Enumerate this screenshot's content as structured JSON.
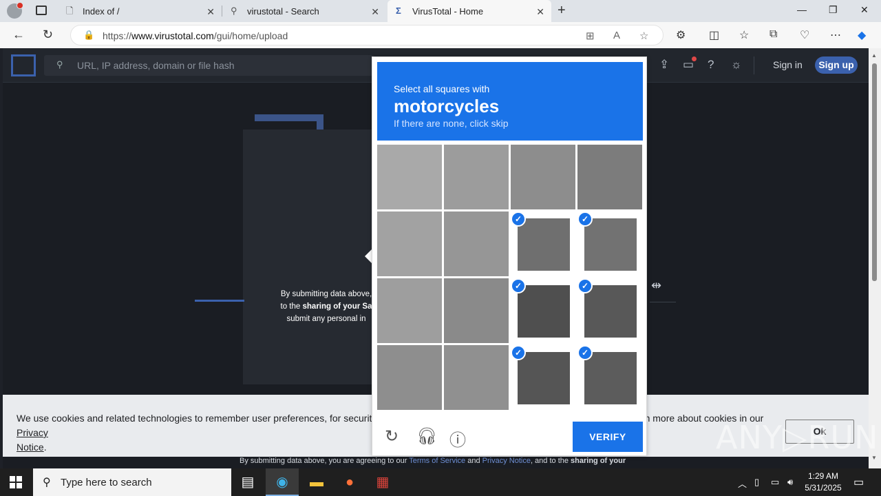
{
  "browser": {
    "tabs": [
      {
        "title": "Index of /",
        "icon": "page-icon"
      },
      {
        "title": "virustotal - Search",
        "icon": "search-icon"
      },
      {
        "title": "VirusTotal - Home",
        "icon": "virustotal-icon"
      }
    ],
    "url_prefix": "https://",
    "url_domain": "www.virustotal.com",
    "url_path": "/gui/home/upload"
  },
  "vt": {
    "search_placeholder": "URL, IP address, domain or file hash",
    "sign_in": "Sign in",
    "sign_up": "Sign up",
    "submit_note_1": "By submitting data above,",
    "submit_note_2": "to the",
    "submit_note_bold": "sharing of your Sa",
    "submit_note_3": "submit any personal in",
    "cookie_text": "We use cookies and related technologies to remember user preferences, for security, to analyse our traffic, and to enable website functionality. Learn more about cookies in our",
    "cookie_link_1": "Privacy",
    "cookie_link_2": "Notice",
    "cookie_end": ".",
    "ok_label": "Ok",
    "footer_pre": "By submitting data above, you are agreeing to our",
    "footer_tos": "Terms of Service",
    "footer_and": "and",
    "footer_pn": "Privacy Notice",
    "footer_post": ", and to the",
    "footer_bold": "sharing of your"
  },
  "captcha": {
    "line1": "Select all squares with",
    "line2": "motorcycles",
    "line3": "If there are none, click skip",
    "verify_label": "VERIFY",
    "selected_cells": [
      6,
      7,
      10,
      11,
      14,
      15
    ],
    "check_mark": "✓"
  },
  "watermark": "ANY▷RUN",
  "taskbar": {
    "search_placeholder": "Type here to search",
    "time": "1:29 AM",
    "date": "5/31/2025"
  }
}
